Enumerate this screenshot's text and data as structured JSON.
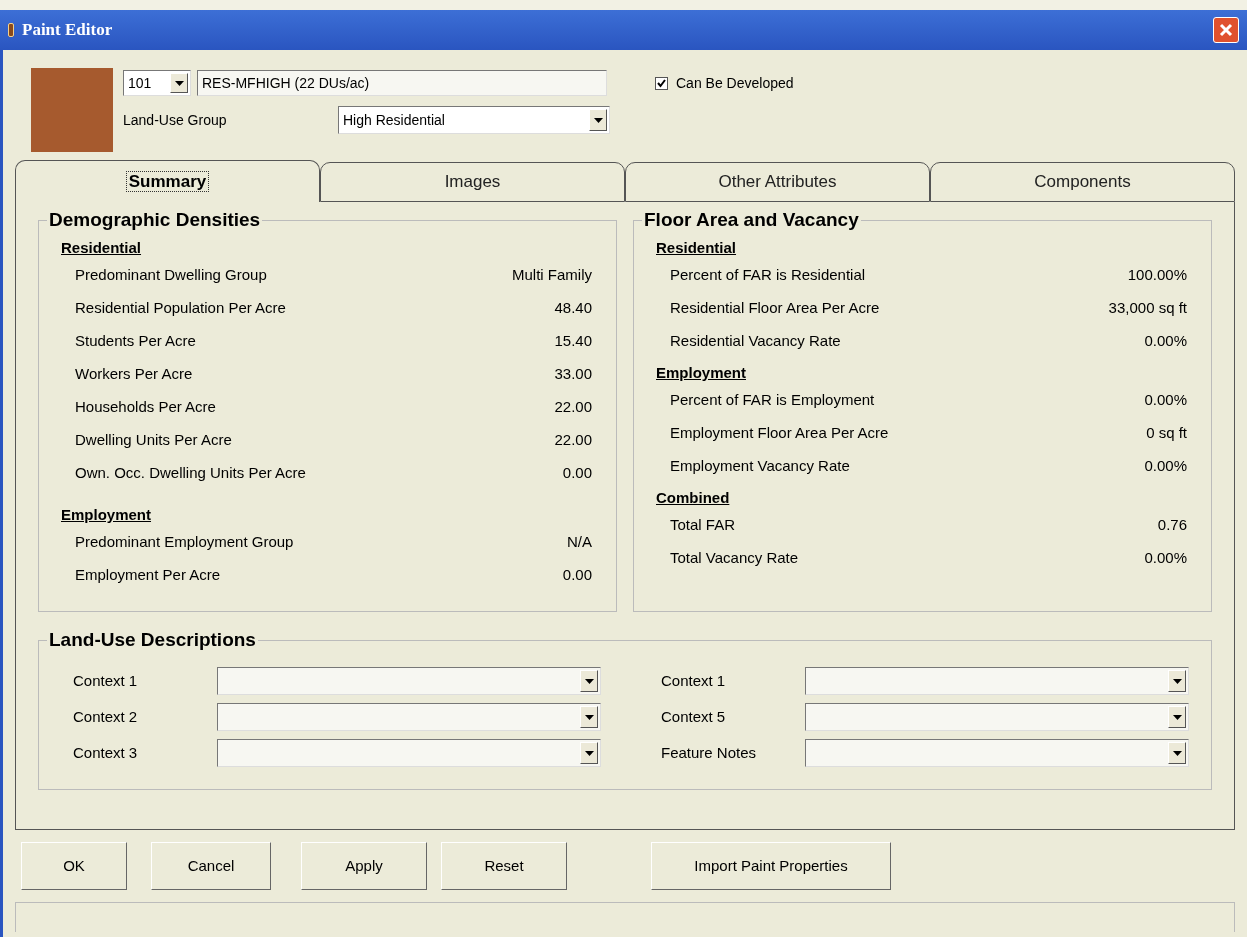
{
  "window": {
    "title": "Paint Editor"
  },
  "header": {
    "code": "101",
    "name": "RES-MFHIGH (22 DUs/ac)",
    "can_be_developed": {
      "label": "Can Be Developed",
      "checked": true
    },
    "group_label": "Land-Use Group",
    "group_value": "High Residential"
  },
  "tabs": [
    {
      "label": "Summary",
      "selected": true
    },
    {
      "label": "Images",
      "selected": false
    },
    {
      "label": "Other Attributes",
      "selected": false
    },
    {
      "label": "Components",
      "selected": false
    }
  ],
  "panels": [
    {
      "title": "Demographic Densities",
      "sections": [
        {
          "heading": "Residential",
          "rows": [
            {
              "label": "Predominant Dwelling Group",
              "value": "Multi Family"
            },
            {
              "label": "Residential Population Per Acre",
              "value": "48.40"
            },
            {
              "label": "Students Per Acre",
              "value": "15.40"
            },
            {
              "label": "Workers Per Acre",
              "value": "33.00"
            },
            {
              "label": "Households Per Acre",
              "value": "22.00"
            },
            {
              "label": "Dwelling Units Per Acre",
              "value": "22.00"
            },
            {
              "label": "Own. Occ. Dwelling Units Per Acre",
              "value": "0.00"
            }
          ]
        },
        {
          "heading": "Employment",
          "rows": [
            {
              "label": "Predominant Employment Group",
              "value": "N/A"
            },
            {
              "label": "Employment Per Acre",
              "value": "0.00"
            }
          ]
        }
      ]
    },
    {
      "title": "Floor Area and Vacancy",
      "sections": [
        {
          "heading": "Residential",
          "rows": [
            {
              "label": "Percent of FAR is Residential",
              "value": "100.00%"
            },
            {
              "label": "Residential Floor Area Per Acre",
              "value": "33,000 sq ft"
            },
            {
              "label": "Residential Vacancy Rate",
              "value": "0.00%"
            }
          ]
        },
        {
          "heading": "Employment",
          "rows": [
            {
              "label": "Percent of FAR is Employment",
              "value": "0.00%"
            },
            {
              "label": "Employment Floor Area Per Acre",
              "value": "0 sq ft"
            },
            {
              "label": "Employment Vacancy Rate",
              "value": "0.00%"
            }
          ]
        },
        {
          "heading": "Combined",
          "rows": [
            {
              "label": "Total FAR",
              "value": "0.76"
            },
            {
              "label": "Total Vacancy Rate",
              "value": "0.00%"
            }
          ]
        }
      ]
    }
  ],
  "descriptions": {
    "title": "Land-Use Descriptions",
    "fields": [
      {
        "label": "Context 1"
      },
      {
        "label": "Context 2"
      },
      {
        "label": "Context 3"
      },
      {
        "label": "Context 1"
      },
      {
        "label": "Context 5"
      },
      {
        "label": "Feature Notes"
      }
    ]
  },
  "buttons": [
    "OK",
    "Cancel",
    "Apply",
    "Reset",
    "Import Paint Properties"
  ]
}
